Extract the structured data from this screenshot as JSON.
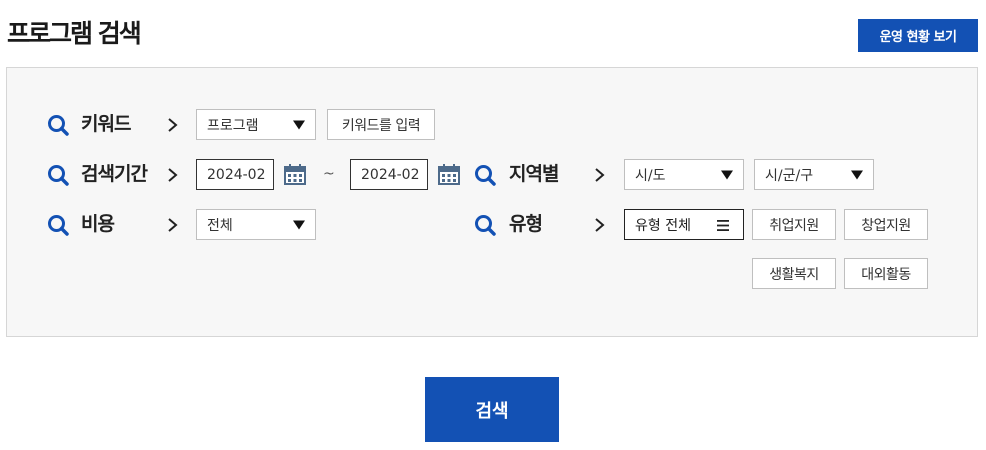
{
  "header": {
    "title": "프로그램 검색",
    "status_button": "운영 현황 보기"
  },
  "filters": {
    "keyword": {
      "label": "키워드",
      "scope_select": "프로그램",
      "input_placeholder": "키워드를 입력"
    },
    "period": {
      "label": "검색기간",
      "start": "2024-02",
      "separator": "~",
      "end": "2024-02"
    },
    "region": {
      "label": "지역별",
      "province_select": "시/도",
      "district_select": "시/군/구"
    },
    "cost": {
      "label": "비용",
      "select": "전체"
    },
    "type": {
      "label": "유형",
      "select": "유형 전체",
      "options": [
        "취업지원",
        "창업지원",
        "생활복지",
        "대외활동"
      ]
    }
  },
  "search_button": "검색",
  "colors": {
    "accent": "#1351b4",
    "calendar": "#4d6a8a"
  },
  "icons": [
    "search-icon",
    "chevron-right-icon",
    "calendar-icon",
    "menu-icon",
    "caret-down-icon"
  ]
}
